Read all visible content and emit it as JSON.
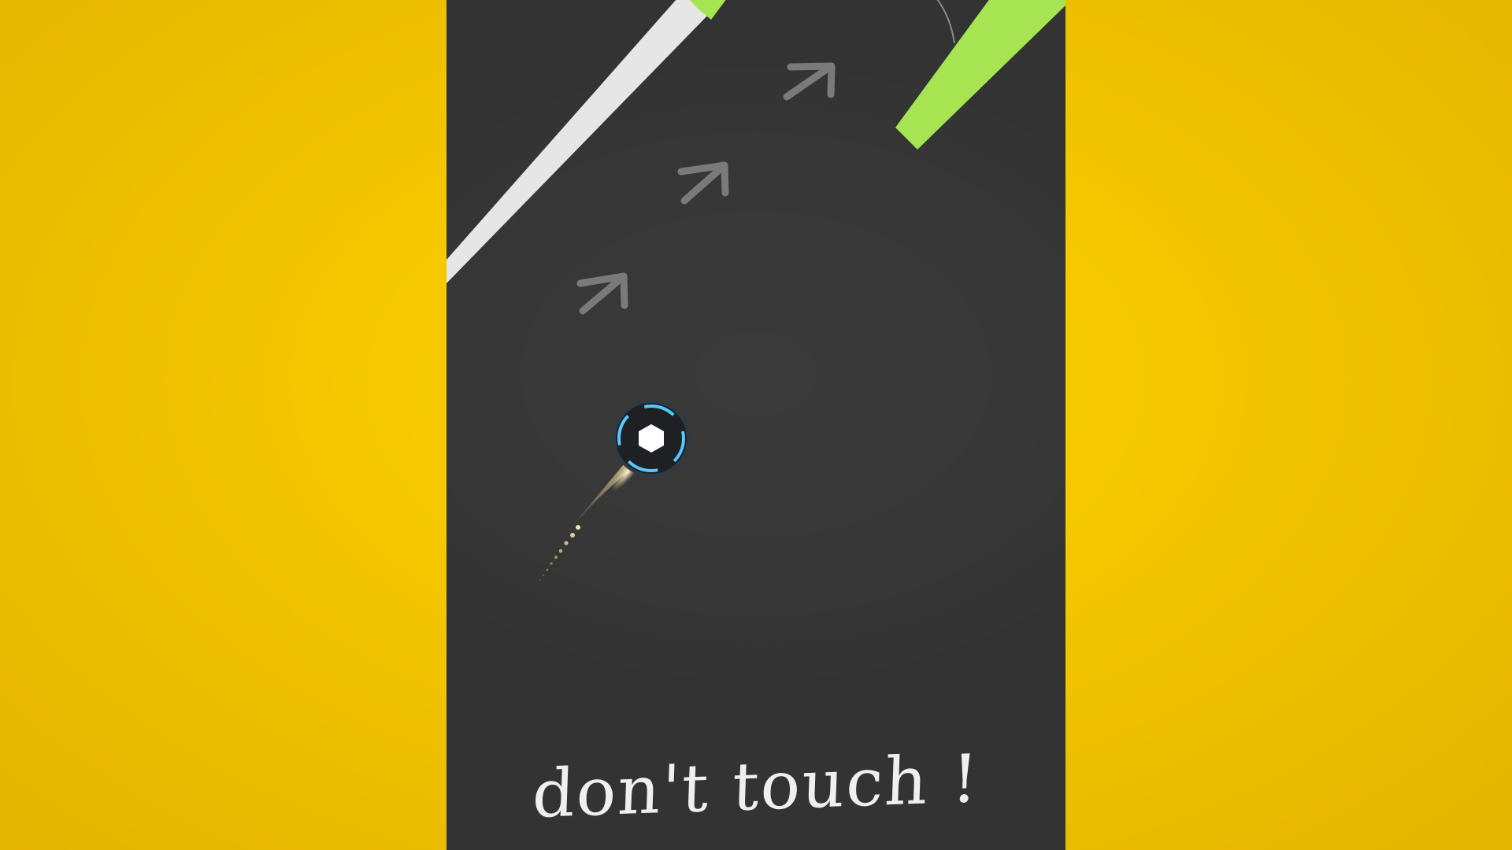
{
  "game": {
    "hint_text": "don't touch !"
  },
  "colors": {
    "background": "#f5c800",
    "playfield": "#333333",
    "wall_white": "#e6e6e6",
    "wall_green": "#a6e452",
    "arrow": "#7a7a7a",
    "ball_ring": "#55c8ff",
    "ball_core": "#ffffff",
    "trail": "#f6e6b0"
  },
  "icons": {
    "direction_arrow": "arrow-up-right-icon",
    "player": "ball-icon"
  }
}
